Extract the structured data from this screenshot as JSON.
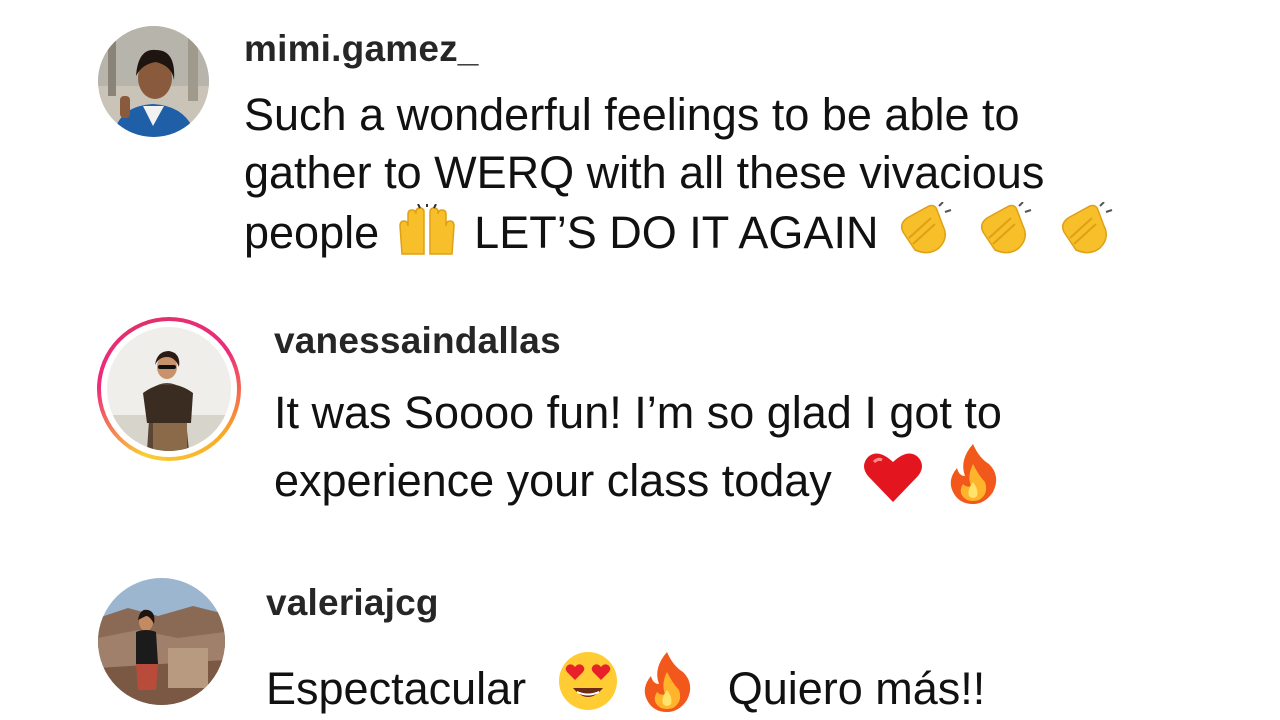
{
  "comments": [
    {
      "username": "mimi.gamez_",
      "has_story_ring": false,
      "lines": [
        "Such a wonderful feelings to be able to",
        "gather to WERQ with all these vivacious"
      ],
      "line3_before": "people",
      "line3_after": "LET’S DO IT AGAIN",
      "emojis": [
        "raising-hands-emoji",
        "clapping-hands-emoji",
        "clapping-hands-emoji",
        "clapping-hands-emoji"
      ]
    },
    {
      "username": "vanessaindallas",
      "has_story_ring": true,
      "lines": [
        "It was Soooo fun! I’m so glad I got to",
        "experience your class today"
      ],
      "emojis": [
        "red-heart-emoji",
        "fire-emoji"
      ]
    },
    {
      "username": "valeriajcg",
      "has_story_ring": false,
      "before": "Espectacular",
      "after": "Quiero más!!",
      "emojis": [
        "heart-eyes-emoji",
        "fire-emoji"
      ]
    }
  ],
  "colors": {
    "username": "#262626",
    "text": "#111111",
    "story_ring": [
      "#f9ce34",
      "#ee2a7b"
    ]
  }
}
